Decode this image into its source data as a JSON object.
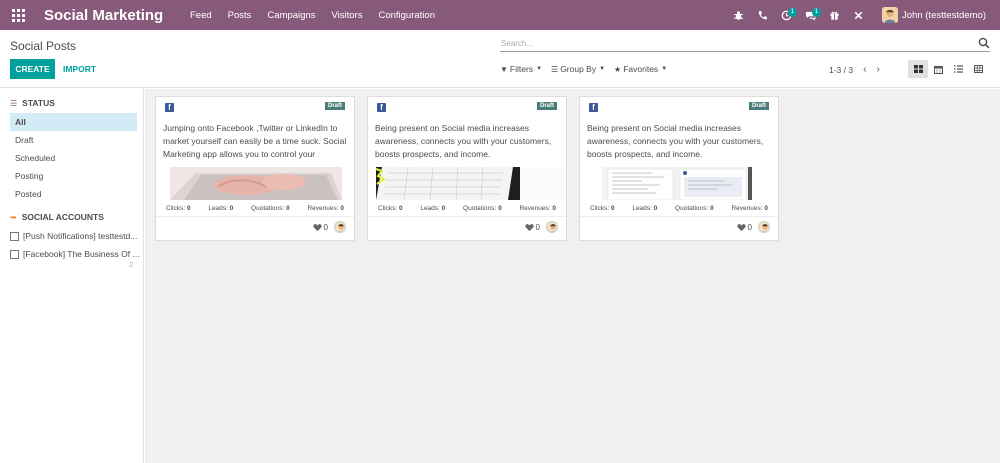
{
  "navbar": {
    "brand": "Social Marketing",
    "menu": [
      "Feed",
      "Posts",
      "Campaigns",
      "Visitors",
      "Configuration"
    ],
    "badge_activities": "1",
    "badge_messages": "1",
    "user_name": "John (testtestdemo)"
  },
  "control": {
    "title": "Social Posts",
    "create_label": "CREATE",
    "import_label": "IMPORT",
    "search_placeholder": "Search...",
    "filters_label": "Filters",
    "groupby_label": "Group By",
    "favorites_label": "Favorites",
    "pager": "1-3 / 3"
  },
  "sidebar": {
    "status_heading": "STATUS",
    "status_items": [
      "All",
      "Draft",
      "Scheduled",
      "Posting",
      "Posted"
    ],
    "accounts_heading": "SOCIAL ACCOUNTS",
    "accounts": [
      "[Push Notifications] testtestd...",
      "[Facebook] The Business Of ..."
    ],
    "accounts_count": "2"
  },
  "cards": [
    {
      "state": "Draft",
      "message": "Jumping onto Facebook ,Twitter or LinkedIn to market yourself can easily be a time suck. Social Marketing app allows you to control your",
      "clicks_label": "Clicks:",
      "clicks": "0",
      "leads_label": "Leads:",
      "leads": "0",
      "quotations_label": "Quotations:",
      "quotations": "0",
      "revenues_label": "Revenues:",
      "revenues": "0",
      "likes": "0"
    },
    {
      "state": "Draft",
      "message": "Being present on Social media increases awareness, connects you with your customers, boosts prospects, and income.",
      "clicks_label": "Clicks:",
      "clicks": "0",
      "leads_label": "Leads:",
      "leads": "0",
      "quotations_label": "Quotations:",
      "quotations": "0",
      "revenues_label": "Revenues:",
      "revenues": "0",
      "likes": "0"
    },
    {
      "state": "Draft",
      "message": "Being present on Social media increases awareness, connects you with your customers, boosts prospects, and income.",
      "clicks_label": "Clicks:",
      "clicks": "0",
      "leads_label": "Leads:",
      "leads": "0",
      "quotations_label": "Quotations:",
      "quotations": "0",
      "revenues_label": "Revenues:",
      "revenues": "0",
      "likes": "0"
    }
  ],
  "colors": {
    "navbar": "#875a7b",
    "primary": "#00a09d",
    "draft_badge": "#4c7c7a",
    "facebook": "#3b5998"
  }
}
